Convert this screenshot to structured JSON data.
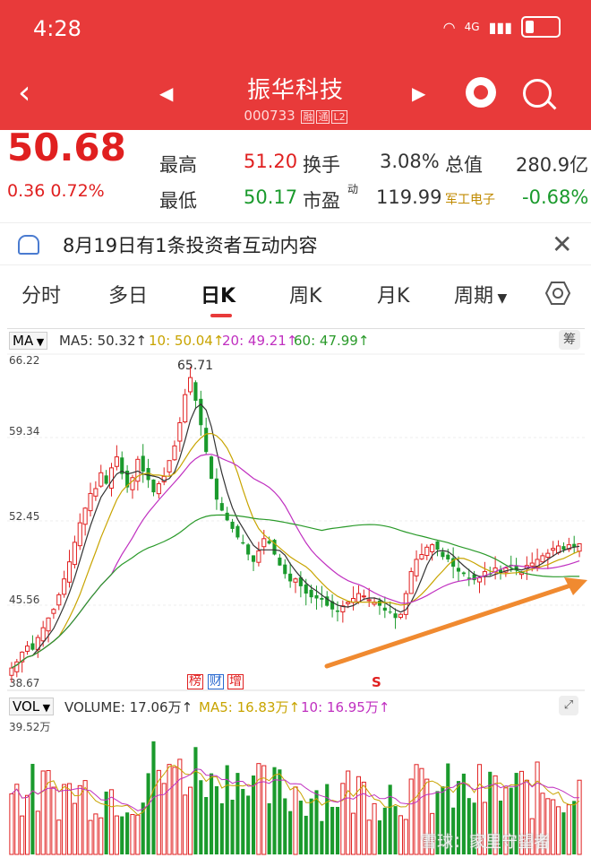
{
  "status": {
    "time": "4:28",
    "network": "4G"
  },
  "header": {
    "title": "振华科技",
    "code": "000733",
    "tags": [
      "融",
      "通",
      "L2"
    ]
  },
  "quote": {
    "price": "50.68",
    "change": "0.36",
    "change_pct": "0.72%",
    "rows": [
      {
        "l1": "最高",
        "v1": "51.20",
        "l2": "换手",
        "v2": "3.08%",
        "l3": "总值",
        "v3": "280.9亿"
      },
      {
        "l1": "最低",
        "v1": "50.17",
        "l2": "市盈",
        "sup": "动",
        "v2": "119.99",
        "l3": "军工电子",
        "v3": "-0.68%"
      }
    ]
  },
  "banner": {
    "text": "8月19日有1条投资者互动内容"
  },
  "tabs": [
    "分时",
    "多日",
    "日K",
    "周K",
    "月K",
    "周期"
  ],
  "active_tab": "日K",
  "ma": {
    "label": "MA",
    "ma5": "MA5: 50.32↑",
    "ma10": "10: 50.04↑",
    "ma20": "20: 49.21↑",
    "ma60": "60: 47.99↑",
    "chip_label": "筹"
  },
  "axis": {
    "y": [
      "66.22",
      "59.34",
      "52.45",
      "45.56",
      "38.67"
    ],
    "peak_label": "65.71"
  },
  "badges": {
    "rank": "榜",
    "finance": "财",
    "add": "增",
    "signal": "S"
  },
  "vol": {
    "label": "VOL",
    "volume": "VOLUME: 17.06万↑",
    "ma5": "MA5: 16.83万↑",
    "ma10": "10: 16.95万↑",
    "max": "39.52万"
  },
  "watermark": "雪球：家里守望者",
  "colors": {
    "up": "#e02020",
    "down": "#1a9a2c",
    "ma5": "#333333",
    "ma10": "#c8a400",
    "ma20": "#c030c0",
    "ma60": "#2a9a2a",
    "arrow": "#f08a30",
    "header": "#e83a3a"
  },
  "chart_data": {
    "type": "candlestick",
    "ylim": [
      38.67,
      66.22
    ],
    "peak": 65.71,
    "closes": [
      40.5,
      41,
      41.8,
      42.3,
      42,
      43,
      43.8,
      44.6,
      45.3,
      46.5,
      47.8,
      49.2,
      50.8,
      52.4,
      53.6,
      54.8,
      55.2,
      56.5,
      55.6,
      56.9,
      57.8,
      56.4,
      55.3,
      56.1,
      57.6,
      56.6,
      55.9,
      54.9,
      55.6,
      56.2,
      57.5,
      58.7,
      60.6,
      62.9,
      64.3,
      62.4,
      60.4,
      58.2,
      56,
      54.3,
      53.4,
      52.6,
      51.9,
      51.2,
      50.7,
      49.8,
      49.2,
      50.1,
      51.1,
      50.7,
      49.8,
      48.9,
      48.2,
      47.6,
      47.8,
      47.2,
      46.6,
      46.3,
      46.2,
      46.1,
      45.6,
      45.3,
      45.1,
      45.6,
      45.9,
      46.2,
      46.6,
      46.4,
      46.1,
      45.9,
      45.6,
      45.2,
      45.1,
      44.6,
      44.9,
      46.6,
      48.4,
      49.4,
      49.8,
      50.4,
      50.6,
      50.2,
      49.6,
      49.4,
      48.8,
      48.4,
      48.2,
      47.8,
      47.7,
      47.9,
      48.4,
      48.2,
      48.7,
      48.3,
      48.7,
      48.9,
      48.5,
      48.3,
      48.9,
      49.1,
      49.4,
      49.7,
      49.9,
      50.3,
      50.5,
      50.2,
      50.6,
      50.4,
      50.68
    ],
    "volume_max": "39.52万"
  }
}
